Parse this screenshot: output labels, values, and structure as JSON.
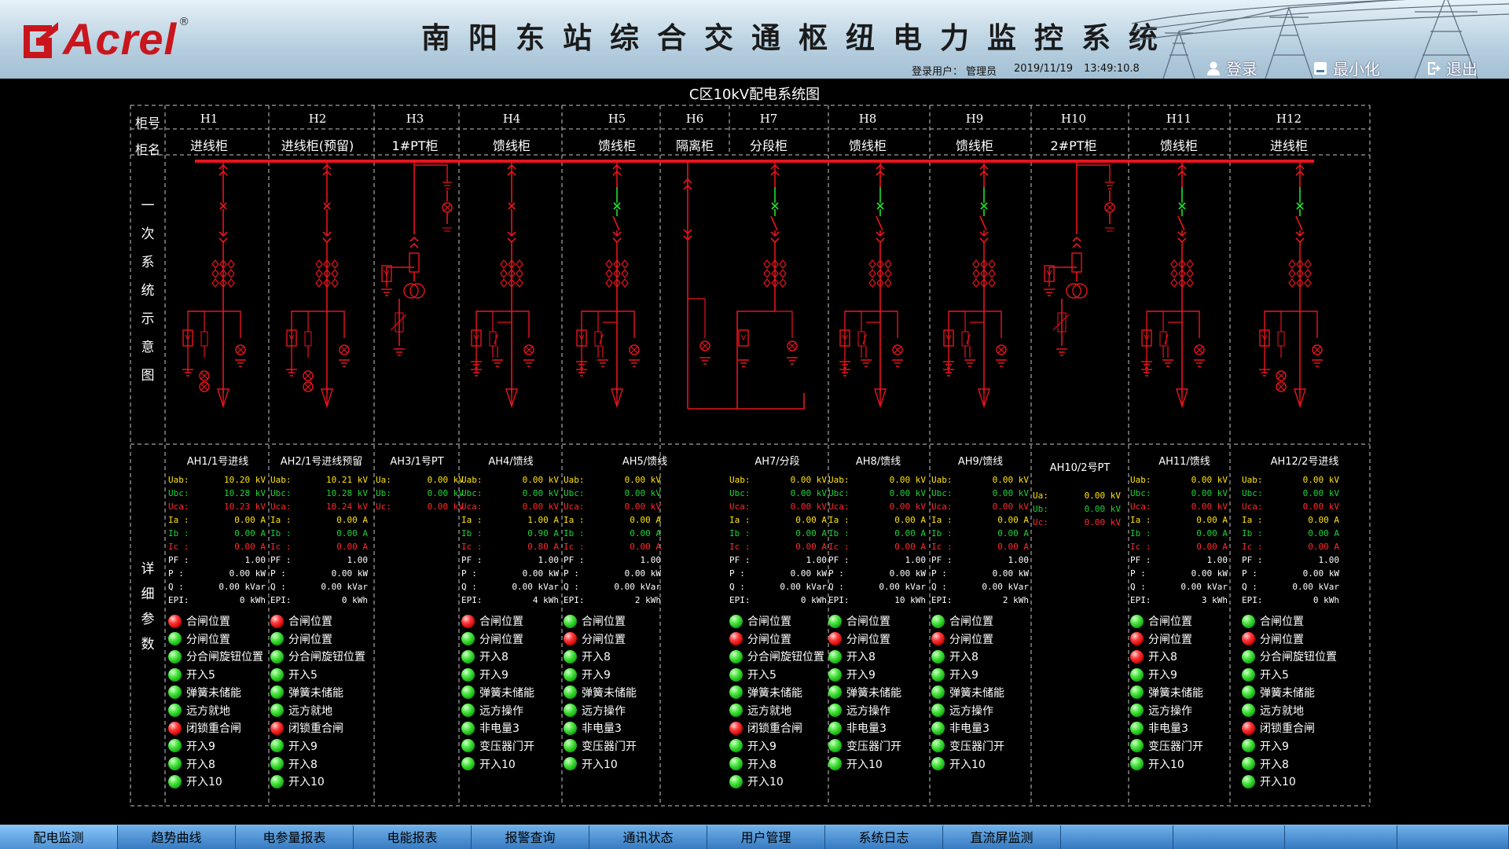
{
  "header": {
    "title": "南阳东站综合交通枢纽电力监控系统",
    "brand": "Acrel",
    "login_label": "登录用户：",
    "user": "管理员",
    "date": "2019/11/19",
    "time": "13:49:10.8",
    "login_btn": "登录",
    "minimize_btn": "最小化",
    "exit_btn": "退出"
  },
  "diagram": {
    "title": "C区10kV配电系统图",
    "row_cabinet_no": "柜号",
    "row_cabinet_name": "柜名",
    "row_primary": [
      "一",
      "次",
      "系",
      "统",
      "示",
      "意",
      "图"
    ],
    "row_detail": [
      "详",
      "细",
      "参",
      "数"
    ]
  },
  "cabinets": [
    {
      "id": "H1",
      "name": "进线柜"
    },
    {
      "id": "H2",
      "name": "进线柜(预留)"
    },
    {
      "id": "H3",
      "name": "1#PT柜"
    },
    {
      "id": "H4",
      "name": "馈线柜"
    },
    {
      "id": "H5",
      "name": "馈线柜"
    },
    {
      "id": "H6",
      "name": "隔离柜"
    },
    {
      "id": "H7",
      "name": "分段柜"
    },
    {
      "id": "H8",
      "name": "馈线柜"
    },
    {
      "id": "H9",
      "name": "馈线柜"
    },
    {
      "id": "H10",
      "name": "2#PT柜"
    },
    {
      "id": "H11",
      "name": "馈线柜"
    },
    {
      "id": "H12",
      "name": "进线柜"
    }
  ],
  "details": [
    {
      "title": "AH1/1号进线",
      "type": "feeder",
      "m": [
        [
          "Uab:",
          "10.20 kV"
        ],
        [
          "Ubc:",
          "10.28 kV"
        ],
        [
          "Uca:",
          "10.23 kV"
        ],
        [
          "Ia :",
          "0.00  A"
        ],
        [
          "Ib :",
          "0.00  A"
        ],
        [
          "Ic :",
          "0.00  A"
        ],
        [
          "PF :",
          "1.00"
        ],
        [
          "P  :",
          "0.00 kW"
        ],
        [
          "Q  :",
          "0.00 kVar"
        ],
        [
          "EPI:",
          "0 kWh"
        ]
      ],
      "sig": [
        [
          "r",
          "合闸位置"
        ],
        [
          "g",
          "分闸位置"
        ],
        [
          "g",
          "分合闸旋钮位置"
        ],
        [
          "g",
          "开入5"
        ],
        [
          "g",
          "弹簧未储能"
        ],
        [
          "g",
          "远方就地"
        ],
        [
          "r",
          "闭锁重合闸"
        ],
        [
          "g",
          "开入9"
        ],
        [
          "g",
          "开入8"
        ],
        [
          "g",
          "开入10"
        ]
      ]
    },
    {
      "title": "AH2/1号进线预留",
      "type": "feeder",
      "m": [
        [
          "Uab:",
          "10.21 kV"
        ],
        [
          "Ubc:",
          "10.28 kV"
        ],
        [
          "Uca:",
          "10.24 kV"
        ],
        [
          "Ia :",
          "0.00  A"
        ],
        [
          "Ib :",
          "0.00  A"
        ],
        [
          "Ic :",
          "0.00  A"
        ],
        [
          "PF :",
          "1.00"
        ],
        [
          "P  :",
          "0.00 kW"
        ],
        [
          "Q  :",
          "0.00 kVar"
        ],
        [
          "EPI:",
          "0 kWh"
        ]
      ],
      "sig": [
        [
          "r",
          "合闸位置"
        ],
        [
          "g",
          "分闸位置"
        ],
        [
          "g",
          "分合闸旋钮位置"
        ],
        [
          "g",
          "开入5"
        ],
        [
          "g",
          "弹簧未储能"
        ],
        [
          "g",
          "远方就地"
        ],
        [
          "r",
          "闭锁重合闸"
        ],
        [
          "g",
          "开入9"
        ],
        [
          "g",
          "开入8"
        ],
        [
          "g",
          "开入10"
        ]
      ]
    },
    {
      "title": "AH3/1号PT",
      "type": "pt",
      "m": [
        [
          "Ua:",
          "0.00 kV"
        ],
        [
          "Ub:",
          "0.00 kV"
        ],
        [
          "Uc:",
          "0.00 kV"
        ]
      ],
      "sig": []
    },
    {
      "title": "AH4/馈线",
      "type": "feeder",
      "m": [
        [
          "Uab:",
          "0.00 kV"
        ],
        [
          "Ubc:",
          "0.00 kV"
        ],
        [
          "Uca:",
          "0.00 kV"
        ],
        [
          "Ia :",
          "1.00  A"
        ],
        [
          "Ib :",
          "0.90  A"
        ],
        [
          "Ic :",
          "0.80  A"
        ],
        [
          "PF :",
          "1.00"
        ],
        [
          "P  :",
          "0.00 kW"
        ],
        [
          "Q  :",
          "0.00 kVar"
        ],
        [
          "EPI:",
          "4 kWh"
        ]
      ],
      "sig": [
        [
          "r",
          "合闸位置"
        ],
        [
          "g",
          "分闸位置"
        ],
        [
          "g",
          "开入8"
        ],
        [
          "g",
          "开入9"
        ],
        [
          "g",
          "弹簧未储能"
        ],
        [
          "g",
          "远方操作"
        ],
        [
          "g",
          "非电量3"
        ],
        [
          "g",
          "变压器门开"
        ],
        [
          "g",
          "开入10"
        ]
      ]
    },
    {
      "title": "AH5/馈线",
      "type": "feeder",
      "m": [
        [
          "Uab:",
          "0.00 kV"
        ],
        [
          "Ubc:",
          "0.00 kV"
        ],
        [
          "Uca:",
          "0.00 kV"
        ],
        [
          "Ia :",
          "0.00  A"
        ],
        [
          "Ib :",
          "0.00  A"
        ],
        [
          "Ic :",
          "0.00  A"
        ],
        [
          "PF :",
          "1.00"
        ],
        [
          "P  :",
          "0.00 kW"
        ],
        [
          "Q  :",
          "0.00 kVar"
        ],
        [
          "EPI:",
          "2 kWh"
        ]
      ],
      "sig": [
        [
          "g",
          "合闸位置"
        ],
        [
          "r",
          "分闸位置"
        ],
        [
          "g",
          "开入8"
        ],
        [
          "g",
          "开入9"
        ],
        [
          "g",
          "弹簧未储能"
        ],
        [
          "g",
          "远方操作"
        ],
        [
          "g",
          "非电量3"
        ],
        [
          "g",
          "变压器门开"
        ],
        [
          "g",
          "开入10"
        ]
      ]
    },
    {
      "title": "",
      "type": "empty",
      "m": [],
      "sig": []
    },
    {
      "title": "AH7/分段",
      "type": "feeder",
      "m": [
        [
          "Uab:",
          "0.00 kV"
        ],
        [
          "Ubc:",
          "0.00 kV"
        ],
        [
          "Uca:",
          "0.00 kV"
        ],
        [
          "Ia :",
          "0.00  A"
        ],
        [
          "Ib :",
          "0.00  A"
        ],
        [
          "Ic :",
          "0.00  A"
        ],
        [
          "PF :",
          "1.00"
        ],
        [
          "P  :",
          "0.00 kW"
        ],
        [
          "Q  :",
          "0.00 kVar"
        ],
        [
          "EPI:",
          "0 kWh"
        ]
      ],
      "sig": [
        [
          "g",
          "合闸位置"
        ],
        [
          "r",
          "分闸位置"
        ],
        [
          "g",
          "分合闸旋钮位置"
        ],
        [
          "g",
          "开入5"
        ],
        [
          "g",
          "弹簧未储能"
        ],
        [
          "g",
          "远方就地"
        ],
        [
          "r",
          "闭锁重合闸"
        ],
        [
          "g",
          "开入9"
        ],
        [
          "g",
          "开入8"
        ],
        [
          "g",
          "开入10"
        ]
      ]
    },
    {
      "title": "AH8/馈线",
      "type": "feeder",
      "m": [
        [
          "Uab:",
          "0.00 kV"
        ],
        [
          "Ubc:",
          "0.00 kV"
        ],
        [
          "Uca:",
          "0.00 kV"
        ],
        [
          "Ia :",
          "0.00  A"
        ],
        [
          "Ib :",
          "0.00  A"
        ],
        [
          "Ic :",
          "0.00  A"
        ],
        [
          "PF :",
          "1.00"
        ],
        [
          "P  :",
          "0.00 kW"
        ],
        [
          "Q  :",
          "0.00 kVar"
        ],
        [
          "EPI:",
          "10 kWh"
        ]
      ],
      "sig": [
        [
          "g",
          "合闸位置"
        ],
        [
          "r",
          "分闸位置"
        ],
        [
          "g",
          "开入8"
        ],
        [
          "g",
          "开入9"
        ],
        [
          "g",
          "弹簧未储能"
        ],
        [
          "g",
          "远方操作"
        ],
        [
          "g",
          "非电量3"
        ],
        [
          "g",
          "变压器门开"
        ],
        [
          "g",
          "开入10"
        ]
      ]
    },
    {
      "title": "AH9/馈线",
      "type": "feeder",
      "m": [
        [
          "Uab:",
          "0.00 kV"
        ],
        [
          "Ubc:",
          "0.00 kV"
        ],
        [
          "Uca:",
          "0.00 kV"
        ],
        [
          "Ia :",
          "0.00  A"
        ],
        [
          "Ib :",
          "0.00  A"
        ],
        [
          "Ic :",
          "0.00  A"
        ],
        [
          "PF :",
          "1.00"
        ],
        [
          "P  :",
          "0.00 kW"
        ],
        [
          "Q  :",
          "0.00 kVar"
        ],
        [
          "EPI:",
          "2 kWh"
        ]
      ],
      "sig": [
        [
          "g",
          "合闸位置"
        ],
        [
          "r",
          "分闸位置"
        ],
        [
          "g",
          "开入8"
        ],
        [
          "g",
          "开入9"
        ],
        [
          "g",
          "弹簧未储能"
        ],
        [
          "g",
          "远方操作"
        ],
        [
          "g",
          "非电量3"
        ],
        [
          "g",
          "变压器门开"
        ],
        [
          "g",
          "开入10"
        ]
      ]
    },
    {
      "title": "AH10/2号PT",
      "type": "pt",
      "m": [
        [
          "Ua:",
          "0.00 kV"
        ],
        [
          "Ub:",
          "0.00 kV"
        ],
        [
          "Uc:",
          "0.00 kV"
        ]
      ],
      "sig": []
    },
    {
      "title": "AH11/馈线",
      "type": "feeder",
      "m": [
        [
          "Uab:",
          "0.00 kV"
        ],
        [
          "Ubc:",
          "0.00 kV"
        ],
        [
          "Uca:",
          "0.00 kV"
        ],
        [
          "Ia :",
          "0.00  A"
        ],
        [
          "Ib :",
          "0.00  A"
        ],
        [
          "Ic :",
          "0.00  A"
        ],
        [
          "PF :",
          "1.00"
        ],
        [
          "P  :",
          "0.00 kW"
        ],
        [
          "Q  :",
          "0.00 kVar"
        ],
        [
          "EPI:",
          "3 kWh"
        ]
      ],
      "sig": [
        [
          "g",
          "合闸位置"
        ],
        [
          "r",
          "分闸位置"
        ],
        [
          "r",
          "开入8"
        ],
        [
          "g",
          "开入9"
        ],
        [
          "g",
          "弹簧未储能"
        ],
        [
          "g",
          "远方操作"
        ],
        [
          "g",
          "非电量3"
        ],
        [
          "g",
          "变压器门开"
        ],
        [
          "g",
          "开入10"
        ]
      ]
    },
    {
      "title": "AH12/2号进线",
      "type": "feeder",
      "m": [
        [
          "Uab:",
          "0.00 kV"
        ],
        [
          "Ubc:",
          "0.00 kV"
        ],
        [
          "Uca:",
          "0.00 kV"
        ],
        [
          "Ia :",
          "0.00  A"
        ],
        [
          "Ib :",
          "0.00  A"
        ],
        [
          "Ic :",
          "0.00  A"
        ],
        [
          "PF :",
          "1.00"
        ],
        [
          "P  :",
          "0.00 kW"
        ],
        [
          "Q  :",
          "0.00 kVar"
        ],
        [
          "EPI:",
          "0 kWh"
        ]
      ],
      "sig": [
        [
          "g",
          "合闸位置"
        ],
        [
          "r",
          "分闸位置"
        ],
        [
          "g",
          "分合闸旋钮位置"
        ],
        [
          "g",
          "开入5"
        ],
        [
          "g",
          "弹簧未储能"
        ],
        [
          "g",
          "远方就地"
        ],
        [
          "r",
          "闭锁重合闸"
        ],
        [
          "g",
          "开入9"
        ],
        [
          "g",
          "开入8"
        ],
        [
          "g",
          "开入10"
        ]
      ]
    }
  ],
  "nav": [
    "配电监测",
    "趋势曲线",
    "电参量报表",
    "电能报表",
    "报警查询",
    "通讯状态",
    "用户管理",
    "系统日志",
    "直流屏监测"
  ],
  "colors": {
    "bus": "#e8141c",
    "closed": "#e8141c",
    "open": "#20e02a",
    "grid": "#c8c8c8"
  }
}
